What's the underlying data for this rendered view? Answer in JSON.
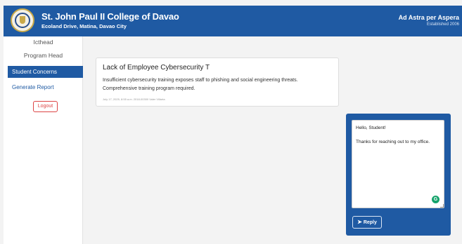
{
  "header": {
    "school_name": "St. John Paul II College of Davao",
    "address": "Ecoland Drive, Matina, Davao City",
    "motto": "Ad Astra per Aspera",
    "established": "Established 2006"
  },
  "sidebar": {
    "user": "Icthead",
    "role": "Program Head",
    "items": [
      {
        "label": "Student Concerns",
        "active": true
      },
      {
        "label": "Generate Report",
        "active": false
      }
    ],
    "logout_label": "Logout"
  },
  "concern": {
    "title": "Lack of Employee Cybersecurity T",
    "body": "Insufficient cybersecurity training exposes staff to phishing and social engineering threats. Comprehensive training program required.",
    "meta": "July 17, 2025, 8:55 a.m. 2018-00300 Valer Villarta"
  },
  "reply": {
    "message": "Hello, Student!\n\nThanks for reaching out to my office.",
    "button_label": "Reply"
  },
  "colors": {
    "primary": "#1f5aa3",
    "danger": "#dd4444"
  }
}
